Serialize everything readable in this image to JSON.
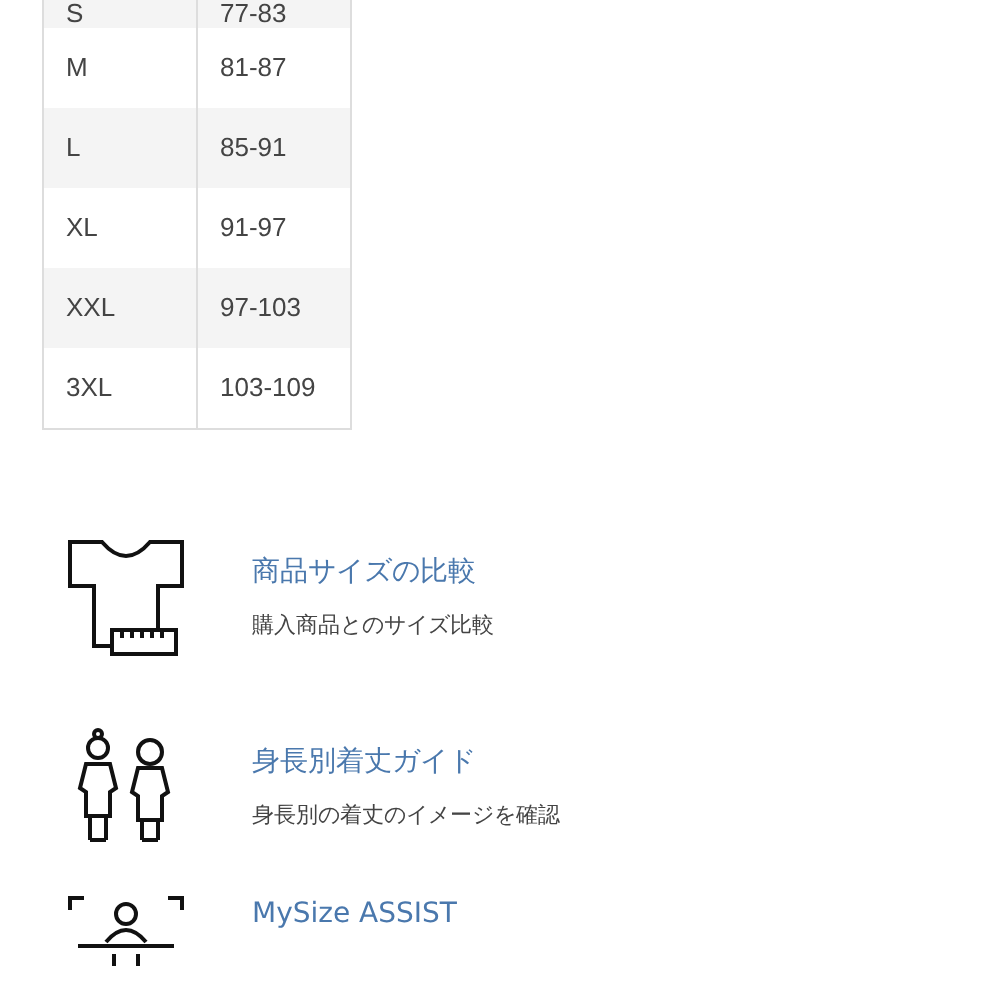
{
  "size_table": {
    "rows": [
      {
        "size": "S",
        "chest": "77-83"
      },
      {
        "size": "M",
        "chest": "81-87"
      },
      {
        "size": "L",
        "chest": "85-91"
      },
      {
        "size": "XL",
        "chest": "91-97"
      },
      {
        "size": "XXL",
        "chest": "97-103"
      },
      {
        "size": "3XL",
        "chest": "103-109"
      }
    ]
  },
  "features": [
    {
      "kind": "shirt",
      "title": "商品サイズの比較",
      "subtitle": "購入商品とのサイズ比較"
    },
    {
      "kind": "figures",
      "title": "身長別着丈ガイド",
      "subtitle": "身長別の着丈のイメージを確認"
    },
    {
      "kind": "scan",
      "title": "MySize ASSIST"
    }
  ]
}
